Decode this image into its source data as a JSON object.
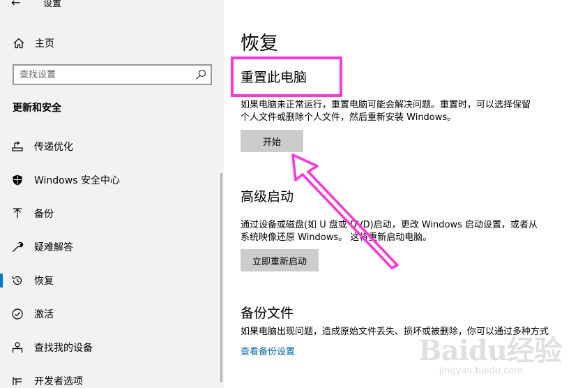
{
  "window": {
    "title": "设置",
    "back_icon": "back-arrow-icon"
  },
  "sidebar": {
    "home": {
      "label": "主页",
      "icon": "home-icon"
    },
    "search": {
      "placeholder": "查找设置",
      "icon": "search-icon"
    },
    "section_title": "更新和安全",
    "items": [
      {
        "label": "传递优化",
        "icon": "delivery-optimization-icon",
        "active": false
      },
      {
        "label": "Windows 安全中心",
        "icon": "shield-icon",
        "active": false
      },
      {
        "label": "备份",
        "icon": "backup-arrow-icon",
        "active": false
      },
      {
        "label": "疑难解答",
        "icon": "wrench-icon",
        "active": false
      },
      {
        "label": "恢复",
        "icon": "recovery-icon",
        "active": true
      },
      {
        "label": "激活",
        "icon": "activation-check-icon",
        "active": false
      },
      {
        "label": "查找我的设备",
        "icon": "find-device-icon",
        "active": false
      },
      {
        "label": "开发者选项",
        "icon": "developer-icon",
        "active": false
      }
    ]
  },
  "main": {
    "title": "恢复",
    "reset": {
      "title": "重置此电脑",
      "desc_line1": "如果电脑未正常运行，重置电脑可能会解决问题。重置时，可以选择保留",
      "desc_line2": "个人文件或删除个人文件，然后重新安装 Windows。",
      "button": "开始"
    },
    "advanced": {
      "title": "高级启动",
      "desc_line1": "通过设备或磁盘(如 U 盘或 DVD)启动，更改 Windows 启动设置，或者从",
      "desc_line2": "系统映像还原 Windows。 这将重新启动电脑。",
      "button": "立即重新启动"
    },
    "backup": {
      "title": "备份文件",
      "desc_line1": "如果电脑出现问题，造成原始文件丢失、损坏或被删除，你可以通过多种方式",
      "link": "查看备份设置"
    }
  },
  "annotation": {
    "color": "#ff33dd"
  },
  "watermark": {
    "logo": "Baidu经验",
    "url": "jingyan.baidu.com"
  },
  "colors": {
    "accent": "#0078d7",
    "link": "#0066b4",
    "sidebar_bg": "#f2f2f2",
    "button_bg": "#cccccc"
  }
}
